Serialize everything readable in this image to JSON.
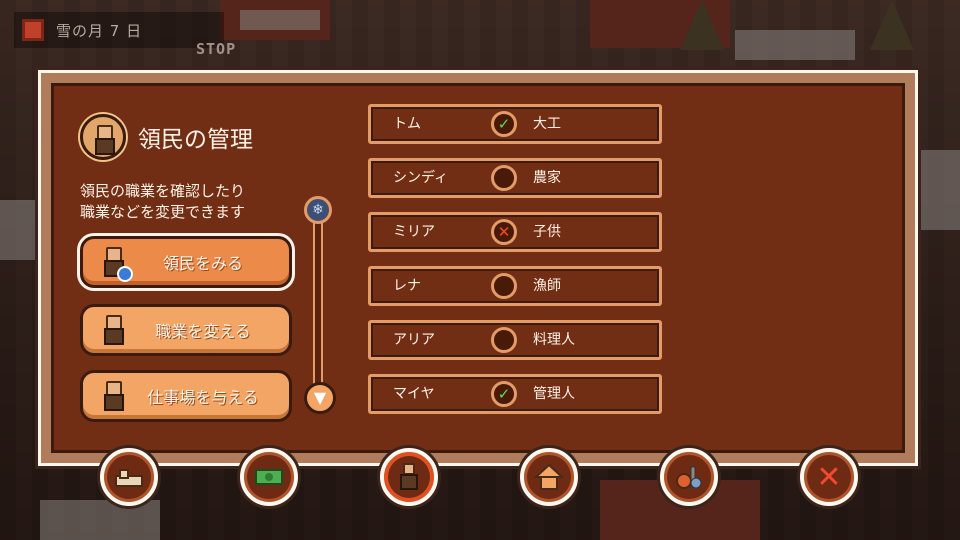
{
  "hud": {
    "date_text": "雪の月 7 日",
    "stop_text": "STOP"
  },
  "panel": {
    "title": "領民の管理",
    "description_line1": "領民の職業を確認したり",
    "description_line2": "職業などを変更できます",
    "menu": [
      {
        "label": "領民をみる",
        "icon": "search-villager-icon",
        "selected": true
      },
      {
        "label": "職業を変える",
        "icon": "change-job-icon",
        "selected": false
      },
      {
        "label": "仕事場を与える",
        "icon": "assign-workplace-icon",
        "selected": false
      }
    ],
    "villagers": [
      {
        "name": "トム",
        "status": "check",
        "job": "大工"
      },
      {
        "name": "シンディ",
        "status": "empty",
        "job": "農家"
      },
      {
        "name": "ミリア",
        "status": "cross",
        "job": "子供"
      },
      {
        "name": "レナ",
        "status": "empty",
        "job": "漁師"
      },
      {
        "name": "アリア",
        "status": "empty",
        "job": "料理人"
      },
      {
        "name": "マイヤ",
        "status": "check",
        "job": "管理人"
      }
    ]
  },
  "toolbar": [
    {
      "icon": "build-icon",
      "active": false
    },
    {
      "icon": "money-icon",
      "active": false
    },
    {
      "icon": "villager-icon",
      "active": true
    },
    {
      "icon": "house-icon",
      "active": false
    },
    {
      "icon": "resources-icon",
      "active": false
    },
    {
      "icon": "close-icon",
      "active": false
    }
  ],
  "colors": {
    "panel_bg": "#722e15",
    "button_orange": "#f2a565",
    "check_green": "#5dd65a",
    "cross_red": "#f04a30"
  }
}
